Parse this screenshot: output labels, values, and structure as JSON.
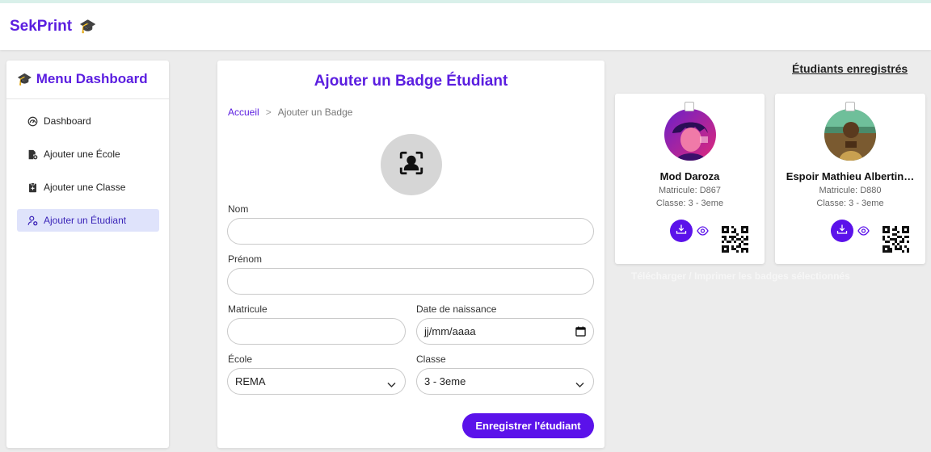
{
  "app": {
    "brand": "SekPrint",
    "brand_icon": "graduation-cap-icon"
  },
  "sidebar": {
    "title": "Menu Dashboard",
    "items": [
      {
        "label": "Dashboard",
        "icon": "dashboard-icon",
        "active": false
      },
      {
        "label": "Ajouter une École",
        "icon": "school-add-icon",
        "active": false
      },
      {
        "label": "Ajouter une Classe",
        "icon": "clipboard-add-icon",
        "active": false
      },
      {
        "label": "Ajouter un Étudiant",
        "icon": "user-add-icon",
        "active": true
      }
    ]
  },
  "form": {
    "title": "Ajouter un Badge Étudiant",
    "breadcrumb": {
      "home": "Accueil",
      "separator": ">",
      "current": "Ajouter un Badge"
    },
    "photo_icon": "face-scan-icon",
    "fields": {
      "nom": {
        "label": "Nom",
        "value": ""
      },
      "prenom": {
        "label": "Prénom",
        "value": ""
      },
      "matricule": {
        "label": "Matricule",
        "value": ""
      },
      "date_naissance": {
        "label": "Date de naissance",
        "placeholder": "jj/mm/aaaa"
      },
      "ecole": {
        "label": "École",
        "selected": "REMA"
      },
      "classe": {
        "label": "Classe",
        "selected": "3 - 3eme"
      }
    },
    "submit_label": "Enregistrer l'étudiant"
  },
  "registered": {
    "title": "Étudiants enregistrés",
    "students": [
      {
        "name": "Mod Daroza",
        "matricule": "Matricule: D867",
        "classe": "Classe: 3 - 3eme"
      },
      {
        "name": "Espoir Mathieu Albertin…",
        "matricule": "Matricule: D880",
        "classe": "Classe: 3 - 3eme"
      }
    ],
    "bulk_action_label": "Télécharger / Imprimer les badges sélectionnés"
  },
  "colors": {
    "accent": "#5b12ea",
    "brand_text": "#5b1ee0",
    "active_bg": "#dfe3fb"
  }
}
